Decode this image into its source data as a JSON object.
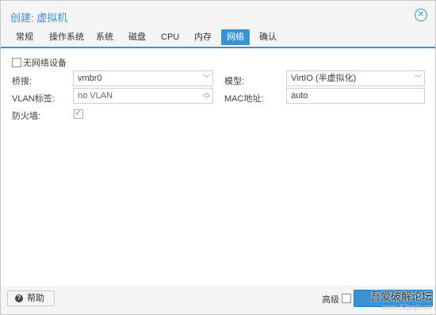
{
  "dialog": {
    "title": "创建: 虚拟机"
  },
  "tabs": [
    {
      "label": "常规",
      "active": false
    },
    {
      "label": "操作系统",
      "active": false
    },
    {
      "label": "系统",
      "active": false
    },
    {
      "label": "磁盘",
      "active": false
    },
    {
      "label": "CPU",
      "active": false
    },
    {
      "label": "内存",
      "active": false
    },
    {
      "label": "网络",
      "active": true
    },
    {
      "label": "确认",
      "active": false
    }
  ],
  "form": {
    "no_network_label": "无网络设备",
    "no_network_checked": false,
    "bridge_label": "桥接:",
    "bridge_value": "vmbr0",
    "vlan_label": "VLAN标签:",
    "vlan_value": "no VLAN",
    "firewall_label": "防火墙:",
    "firewall_checked": true,
    "model_label": "模型:",
    "model_value": "VirtIO (半虚拟化)",
    "mac_label": "MAC地址:",
    "mac_value": "auto"
  },
  "footer": {
    "help_label": "帮助",
    "advanced_label": "高级",
    "advanced_checked": false
  },
  "watermark": {
    "text": "吾爱破解论坛",
    "url": "www.52pojie.cn"
  },
  "colors": {
    "accent": "#3892d4",
    "background": "#f5f5f5",
    "panel": "#ffffff"
  }
}
